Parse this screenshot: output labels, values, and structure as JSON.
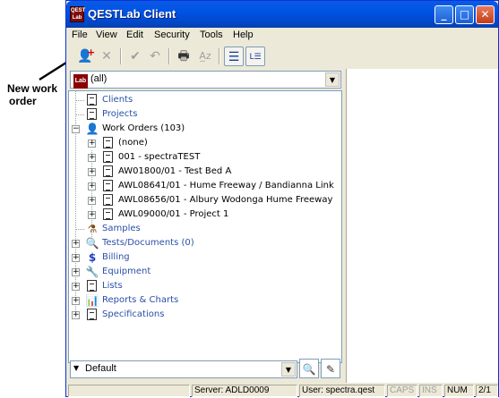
{
  "callout": {
    "text_line1": "New work",
    "text_line2": "order"
  },
  "window": {
    "title": "QESTLab Client",
    "app_icon_text": "QEST Lab",
    "minimize_glyph": "_",
    "maximize_glyph": "□",
    "close_glyph": "✕"
  },
  "menu": [
    "File",
    "View",
    "Edit",
    "Security",
    "Tools",
    "Help"
  ],
  "toolbar_icons": [
    "new-work-order-icon",
    "delete-icon",
    "check-icon",
    "undo-icon",
    "print-icon",
    "spell-check-icon",
    "tree-view-icon",
    "lab-tree-icon"
  ],
  "lab_combo": {
    "icon_text": "Lab",
    "value": "(all)"
  },
  "tree": {
    "clients": "Clients",
    "projects": "Projects",
    "work_orders": "Work Orders (103)",
    "wo_items": [
      "(none)",
      "001 - spectraTEST",
      "AW01800/01 - Test Bed A",
      "AWL08641/01 - Hume Freeway / Bandianna Link",
      "AWL08656/01 - Albury Wodonga Hume Freeway",
      "AWL09000/01 - Project 1"
    ],
    "samples": "Samples",
    "tests": "Tests/Documents (0)",
    "billing": "Billing",
    "equipment": "Equipment",
    "lists": "Lists",
    "reports": "Reports & Charts",
    "specifications": "Specifications"
  },
  "bottom_combo": {
    "value": "Default"
  },
  "status": {
    "server": "Server: ADLD0009",
    "user": "User: spectra.qest",
    "caps": "CAPS",
    "ins": "INS",
    "num": "NUM",
    "page": "2/1"
  }
}
